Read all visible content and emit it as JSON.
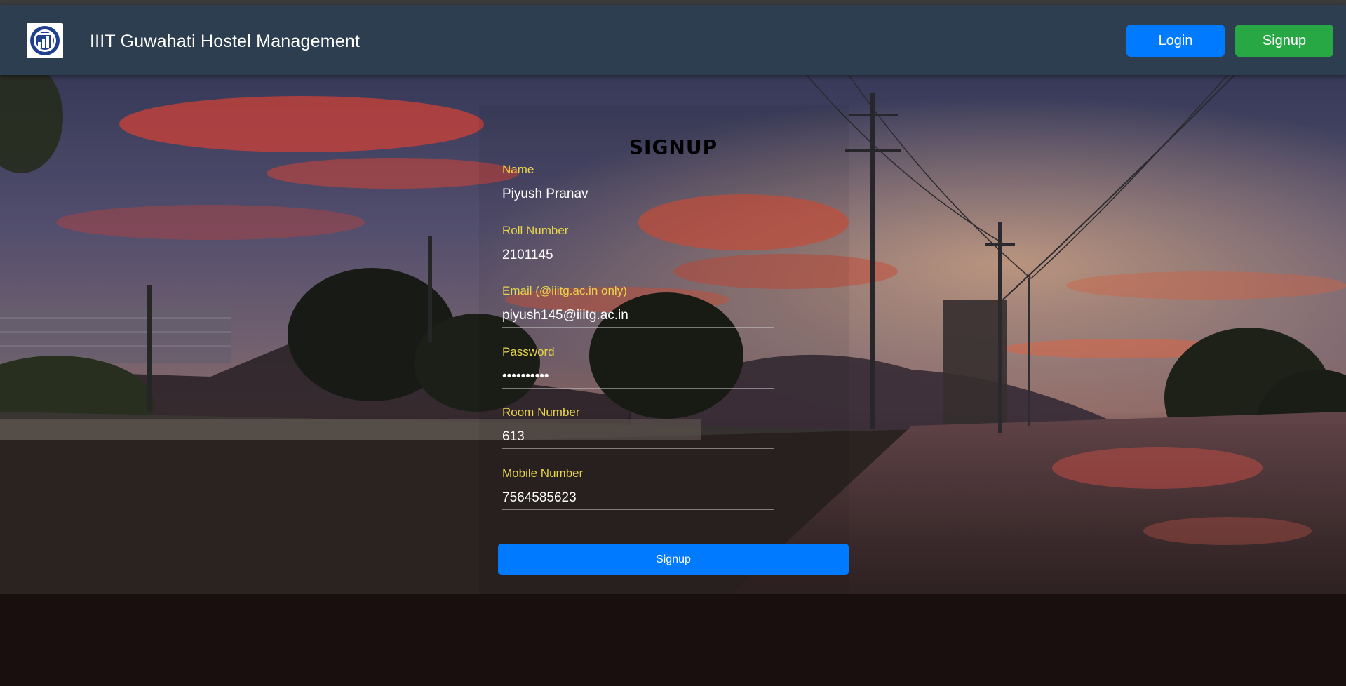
{
  "navbar": {
    "brand": "IIIT Guwahati Hostel Management",
    "login_label": "Login",
    "signup_label": "Signup"
  },
  "form": {
    "title": "SIGNUP",
    "fields": [
      {
        "label": "Name",
        "value": "Piyush Pranav",
        "type": "text"
      },
      {
        "label": "Roll Number",
        "value": "2101145",
        "type": "text"
      },
      {
        "label": "Email (@iiitg.ac.in only)",
        "value": "piyush145@iiitg.ac.in",
        "type": "email"
      },
      {
        "label": "Password",
        "value": "••••••••••",
        "type": "password"
      },
      {
        "label": "Room Number",
        "value": "613",
        "type": "text"
      },
      {
        "label": "Mobile Number",
        "value": "7564585623",
        "type": "text"
      }
    ],
    "submit_label": "Signup"
  },
  "colors": {
    "navbar_bg": "#2c3e50",
    "login_button": "#007bff",
    "signup_button": "#28a745",
    "label_color": "#e8d44d",
    "submit_button": "#007bff"
  },
  "icons": {
    "logo": "iiitg-logo-icon"
  }
}
